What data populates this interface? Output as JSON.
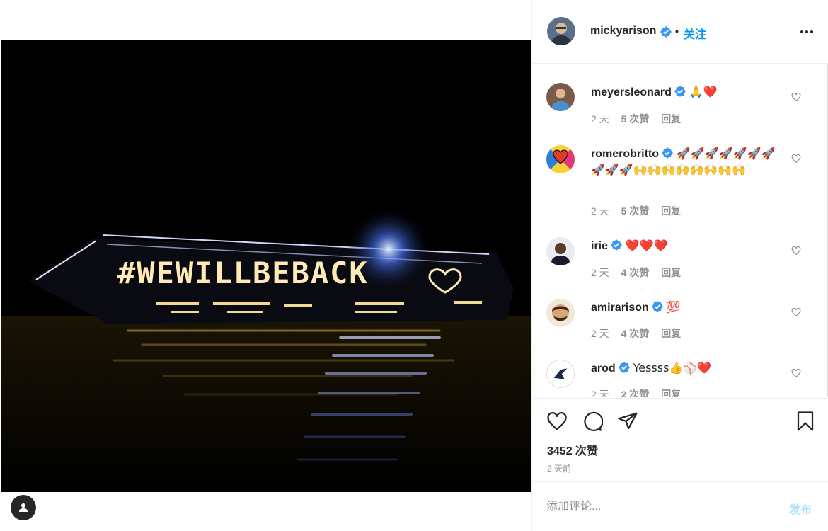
{
  "post": {
    "author": "mickyarison",
    "follow_label": "关注",
    "dot": "•",
    "likes_text": "3452 次赞",
    "time_text": "2 天前",
    "photo_lettering": "#WEWILLBEBACK"
  },
  "comments": [
    {
      "username": "meyersleonard",
      "text": "🙏❤️",
      "age": "2 天",
      "likes": "5 次赞",
      "reply": "回复"
    },
    {
      "username": "romerobritto",
      "text": "🚀🚀🚀🚀🚀🚀🚀🚀🚀🚀🙌🙌🙌🙌🙌🙌🙌🙌",
      "age": "2 天",
      "likes": "5 次赞",
      "reply": "回复"
    },
    {
      "username": "irie",
      "text": "❤️❤️❤️",
      "age": "2 天",
      "likes": "4 次赞",
      "reply": "回复"
    },
    {
      "username": "amirarison",
      "text": "💯",
      "age": "2 天",
      "likes": "4 次赞",
      "reply": "回复"
    },
    {
      "username": "arod",
      "text": "Yessss👍⚾❤️",
      "age": "2 天",
      "likes": "2 次赞",
      "reply": "回复"
    }
  ],
  "composer": {
    "placeholder": "添加评论...",
    "post_label": "发布"
  },
  "colors": {
    "accent": "#0095f6",
    "verified": "#3897f0",
    "muted": "#8e8e8e",
    "post_disabled": "#b2dffc"
  },
  "icons": [
    "verified-badge-icon",
    "more-options-icon",
    "heart-icon",
    "comment-icon",
    "share-icon",
    "bookmark-icon",
    "user-tag-icon"
  ]
}
